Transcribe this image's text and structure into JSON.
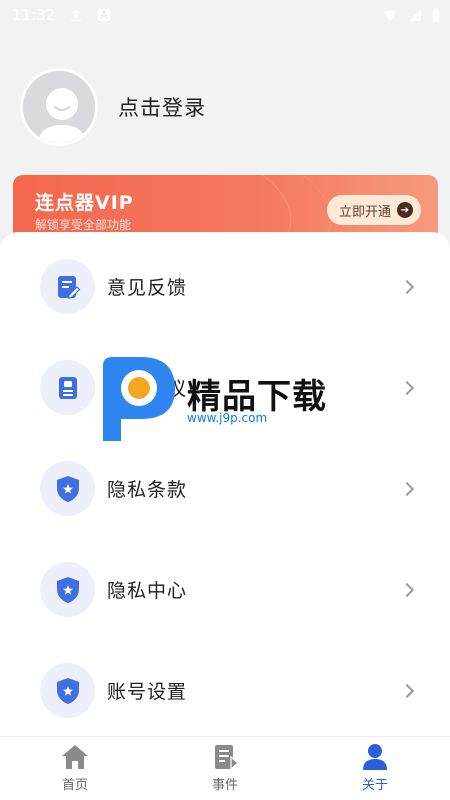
{
  "status_bar": {
    "time": "11:32"
  },
  "profile": {
    "login_label": "点击登录"
  },
  "vip": {
    "title": "连点器VIP",
    "subtitle": "解锁享受全部功能",
    "button_label": "立即开通"
  },
  "menu": {
    "items": [
      {
        "label": "意见反馈",
        "icon": "edit-document-icon"
      },
      {
        "label": "用户协议",
        "icon": "contract-document-icon"
      },
      {
        "label": "隐私条款",
        "icon": "shield-star-icon"
      },
      {
        "label": "隐私中心",
        "icon": "shield-star-icon"
      },
      {
        "label": "账号设置",
        "icon": "shield-star-icon"
      }
    ]
  },
  "watermark": {
    "text": "精品下载",
    "url": "www.j9p.com"
  },
  "tabs": [
    {
      "label": "首页",
      "icon": "home-icon",
      "active": false
    },
    {
      "label": "事件",
      "icon": "events-icon",
      "active": false
    },
    {
      "label": "关于",
      "icon": "user-icon",
      "active": true
    }
  ],
  "colors": {
    "accent": "#2d5fdc",
    "vip": "#f4674e",
    "icon_bg": "#edf0fb"
  }
}
